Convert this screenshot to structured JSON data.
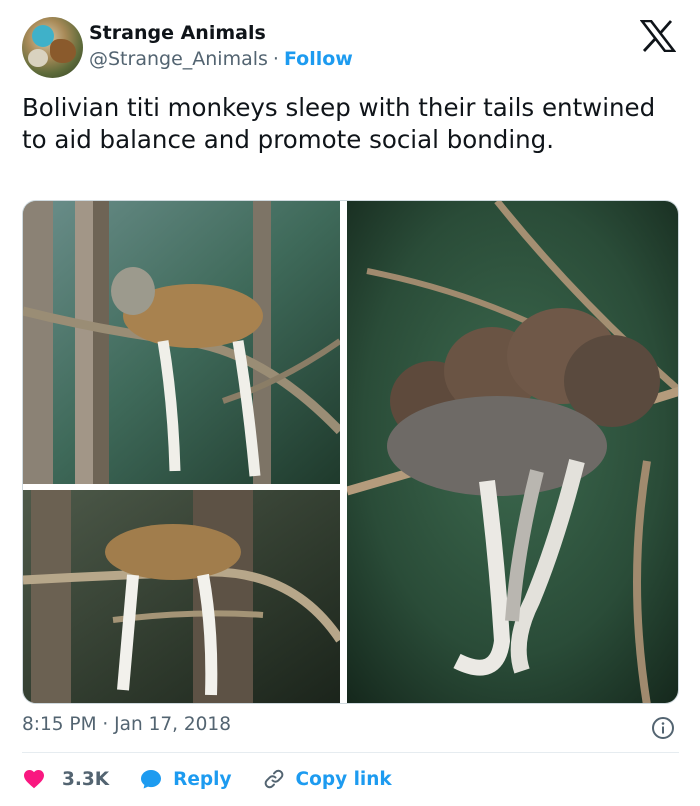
{
  "author": {
    "display_name": "Strange Animals",
    "handle": "@Strange_Animals",
    "separator": "·",
    "follow_label": "Follow",
    "avatar_icon": "avatar-image"
  },
  "brand": {
    "logo_icon": "x-logo-icon"
  },
  "tweet": {
    "text": "Bolivian titi monkeys sleep with their tails entwined to aid balance and promote social bonding."
  },
  "media": {
    "photos": [
      {
        "name": "photo-monkey-on-branch-side-view"
      },
      {
        "name": "photo-monkey-on-branch-back-view"
      },
      {
        "name": "photo-monkeys-huddled-tails-entwined"
      }
    ]
  },
  "meta": {
    "timestamp": "8:15 PM · Jan 17, 2018",
    "info_icon": "info-icon"
  },
  "actions": {
    "like_count": "3.3K",
    "reply_label": "Reply",
    "copy_link_label": "Copy link"
  },
  "colors": {
    "accent": "#1d9bf0",
    "like": "#f91880",
    "muted": "#536471",
    "text": "#0f1419"
  }
}
